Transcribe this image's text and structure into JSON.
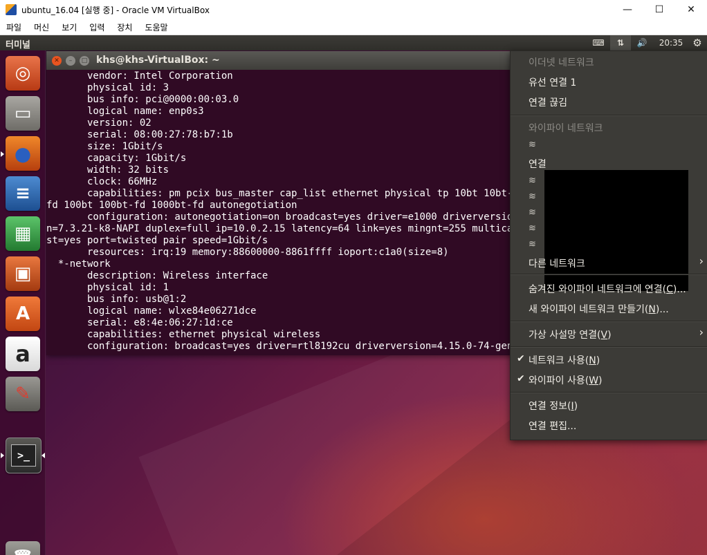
{
  "vbox": {
    "title": "ubuntu_16.04 [실행 중] - Oracle VM VirtualBox",
    "controls": {
      "minimize": "—",
      "maximize": "☐",
      "close": "✕"
    },
    "menu": [
      "파일",
      "머신",
      "보기",
      "입력",
      "장치",
      "도움말"
    ]
  },
  "topbar": {
    "app_title": "터미널",
    "keyboard_icon": "⌨",
    "network_icon": "⇅",
    "volume_icon": "🔊",
    "time": "20:35",
    "settings_icon": "⚙"
  },
  "launcher": {
    "items": [
      {
        "name": "ubuntu-dash",
        "glyph": "◎",
        "color": "#dd4814"
      },
      {
        "name": "files",
        "glyph": "▭",
        "color": "#8e8c87"
      },
      {
        "name": "firefox",
        "glyph": "●",
        "color": "#e66000"
      },
      {
        "name": "libreoffice-writer",
        "glyph": "≡",
        "color": "#2a6ebb"
      },
      {
        "name": "libreoffice-calc",
        "glyph": "▦",
        "color": "#3aa64a"
      },
      {
        "name": "libreoffice-impress",
        "glyph": "▣",
        "color": "#d2561f"
      },
      {
        "name": "software-center",
        "glyph": "A",
        "color": "#e8571c"
      },
      {
        "name": "amazon",
        "glyph": "a",
        "color": "#f2f2f2"
      },
      {
        "name": "system-settings",
        "glyph": "✎",
        "color": "#7b7a75"
      },
      {
        "name": "terminal",
        "glyph": ">_",
        "color": "#2b2b2b"
      },
      {
        "name": "trash",
        "glyph": "🗑",
        "color": "#6e6d68"
      }
    ]
  },
  "terminal": {
    "title": "khs@khs-VirtualBox: ~",
    "lines": [
      "       vendor: Intel Corporation",
      "       physical id: 3",
      "       bus info: pci@0000:00:03.0",
      "       logical name: enp0s3",
      "       version: 02",
      "       serial: 08:00:27:78:b7:1b",
      "       size: 1Gbit/s",
      "       capacity: 1Gbit/s",
      "       width: 32 bits",
      "       clock: 66MHz",
      "       capabilities: pm pcix bus_master cap_list ethernet physical tp 10bt 10bt-",
      "fd 100bt 100bt-fd 1000bt-fd autonegotiation",
      "       configuration: autonegotiation=on broadcast=yes driver=e1000 driverversio",
      "n=7.3.21-k8-NAPI duplex=full ip=10.0.2.15 latency=64 link=yes mingnt=255 multica",
      "st=yes port=twisted pair speed=1Gbit/s",
      "       resources: irq:19 memory:88600000-8861ffff ioport:c1a0(size=8)",
      "  *-network",
      "       description: Wireless interface",
      "       physical id: 1",
      "       bus info: usb@1:2",
      "       logical name: wlxe84e06271dce",
      "       serial: e8:4e:06:27:1d:ce",
      "       capabilities: ethernet physical wireless",
      "       configuration: broadcast=yes driver=rtl8192cu driverversion=4.15.0-74-gen"
    ]
  },
  "network_menu": {
    "ethernet_header": "이더넷 네트워크",
    "wired_connection": "유선 연결 1",
    "disconnect": "연결 끊김",
    "wifi_header": "와이파이 네트워크",
    "wifi_connect_label": "연결",
    "other_networks": "다른 네트워크",
    "hidden_wifi": "숨겨진 와이파이 네트워크에 연결(",
    "hidden_wifi_key": "C",
    "hidden_wifi_tail": ")...",
    "new_wifi": "새 와이파이 네트워크 만들기(",
    "new_wifi_key": "N",
    "new_wifi_tail": ")...",
    "vpn": "가상 사설망 연결(",
    "vpn_key": "V",
    "vpn_tail": ")",
    "enable_network": "네트워크 사용(",
    "enable_network_key": "N",
    "enable_network_tail": ")",
    "enable_wifi": "와이파이 사용(",
    "enable_wifi_key": "W",
    "enable_wifi_tail": ")",
    "conn_info": "연결 정보(",
    "conn_info_key": "I",
    "conn_info_tail": ")",
    "edit_conn": "연결 편집...",
    "check": "✔",
    "arrow": "›",
    "wifi_glyph": "≋"
  }
}
